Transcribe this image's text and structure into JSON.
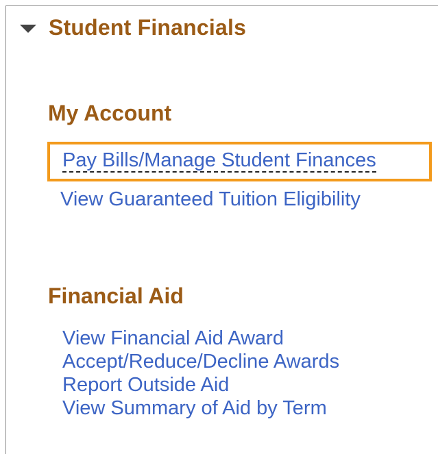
{
  "header": {
    "title": "Student Financials",
    "icon": "caret-down-icon"
  },
  "sections": [
    {
      "title": "My Account",
      "links": [
        "Pay Bills/Manage Student Finances",
        "View Guaranteed Tuition Eligibility"
      ]
    },
    {
      "title": "Financial Aid",
      "links": [
        "View Financial Aid Award",
        "Accept/Reduce/Decline Awards",
        "Report Outside Aid",
        "View Summary of Aid by Term"
      ]
    }
  ],
  "colors": {
    "heading": "#9b5b16",
    "link": "#3c64c4",
    "highlight": "#f39a1c",
    "border": "#8a8a8a"
  }
}
